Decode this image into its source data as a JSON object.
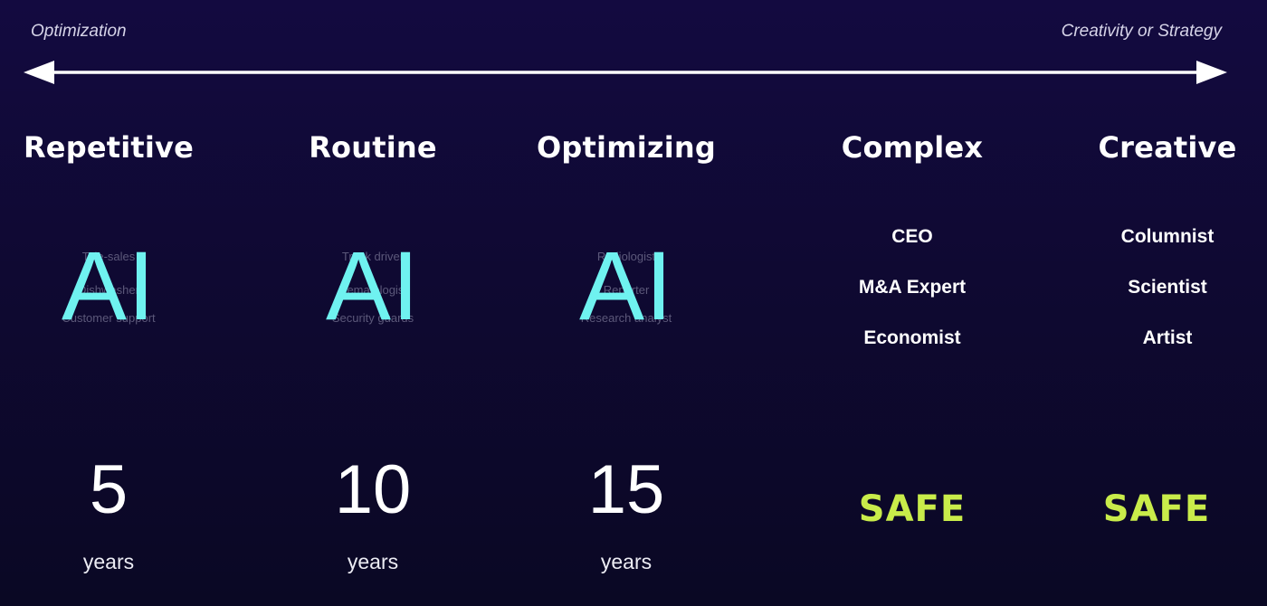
{
  "spectrum": {
    "left_label": "Optimization",
    "right_label": "Creativity or Strategy"
  },
  "columns": [
    {
      "heading": "Repetitive",
      "jobs": [
        "Tele-sales",
        "Dishwasher",
        "Customer support"
      ],
      "ai_label": "AI",
      "count": "5",
      "unit": "years"
    },
    {
      "heading": "Routine",
      "jobs": [
        "Truck driver",
        "Hematologist",
        "Security guards"
      ],
      "ai_label": "AI",
      "count": "10",
      "unit": "years"
    },
    {
      "heading": "Optimizing",
      "jobs": [
        "Radiologist",
        "Reporter",
        "Research analyst"
      ],
      "ai_label": "AI",
      "count": "15",
      "unit": "years"
    },
    {
      "heading": "Complex",
      "jobs": [
        "CEO",
        "M&A Expert",
        "Economist"
      ],
      "status": "SAFE"
    },
    {
      "heading": "Creative",
      "jobs": [
        "Columnist",
        "Scientist",
        "Artist"
      ],
      "status": "SAFE"
    }
  ],
  "colors": {
    "ai_label": "#6ff2f0",
    "safe": "#c9ec4a",
    "background": "#120a3c"
  }
}
